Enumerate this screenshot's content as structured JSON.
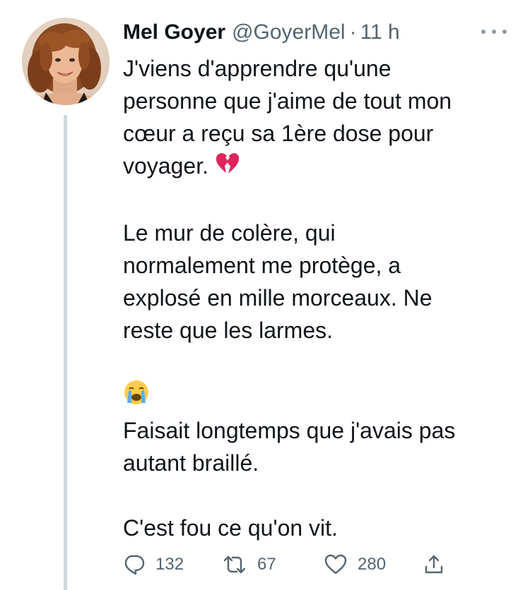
{
  "tweet": {
    "author_name": "Mel Goyer",
    "handle": "@GoyerMel",
    "separator": "·",
    "time": "11 h",
    "paragraphs": [
      {
        "lines": [
          "J'viens d'apprendre qu'une",
          "personne que j'aime de tout mon",
          "cœur a reçu sa 1ère dose pour"
        ],
        "last_line": "voyager.",
        "trailing_emoji": "broken-heart-emoji"
      },
      {
        "lines": [
          "Le mur de colère, qui",
          "normalement me protège, a",
          "explosé en mille morceaux. Ne",
          "reste que les larmes."
        ]
      },
      {
        "leading_emoji": "loudly-crying-face-emoji",
        "lines": [
          "Faisait longtemps que j'avais pas",
          "autant braillé."
        ]
      },
      {
        "lines": [
          "C'est fou ce qu'on vit."
        ]
      }
    ],
    "actions": {
      "reply_count": "132",
      "retweet_count": "67",
      "like_count": "280"
    }
  },
  "icons": {
    "reply": "speech-bubble-icon",
    "retweet": "retweet-arrows-icon",
    "like": "heart-outline-icon",
    "share": "share-upload-icon",
    "more": "more-dots-icon"
  },
  "colors": {
    "text": "#0f1419",
    "secondary": "#536471",
    "thread_line": "#cfd9de",
    "broken_heart": "#e0245e",
    "crying_face": "#ffcc4d",
    "tears": "#5dadec"
  }
}
